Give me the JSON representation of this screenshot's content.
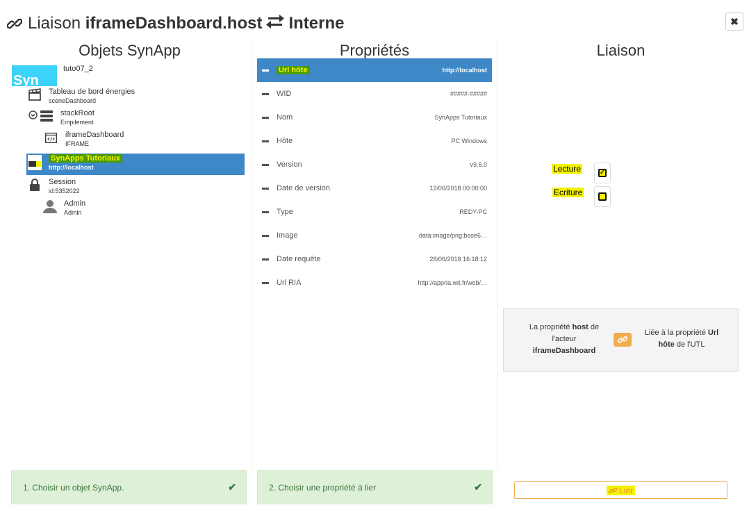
{
  "header": {
    "prefix": "Liaison",
    "source": "iframeDashboard.host",
    "target": "Interne",
    "close_label": "✖"
  },
  "columns": {
    "objects_title": "Objets SynApp",
    "properties_title": "Propriétés",
    "liaison_title": "Liaison"
  },
  "tree": {
    "logo_text": "Syn",
    "root_label": "tuto07_2",
    "items": [
      {
        "label": "Tableau de bord énergies",
        "sub": "sceneDashboard"
      },
      {
        "label": "stackRoot",
        "sub": "Empilement"
      },
      {
        "label": "iframeDashboard",
        "sub": "IFRAME"
      },
      {
        "label": "SynApps Tutoriaux",
        "sub": "http://localhost"
      },
      {
        "label": "Session",
        "sub": "id:5352022"
      },
      {
        "label": "Admin",
        "sub": "Admin"
      }
    ]
  },
  "properties": [
    {
      "name": "Url hôte",
      "value": "http://localhost"
    },
    {
      "name": "WID",
      "value": "#####-#####"
    },
    {
      "name": "Nom",
      "value": "SynApps Tutoriaux"
    },
    {
      "name": "Hôte",
      "value": "PC Windows"
    },
    {
      "name": "Version",
      "value": "v9.6.0"
    },
    {
      "name": "Date de version",
      "value": "12/06/2018 00:00:00"
    },
    {
      "name": "Type",
      "value": "REDY-PC"
    },
    {
      "name": "Image",
      "value": "data:image/png;base6…"
    },
    {
      "name": "Date requête",
      "value": "28/06/2018 16:18:12"
    },
    {
      "name": "Url RIA",
      "value": "http://appria.wit.fr/web/…"
    }
  ],
  "liaison": {
    "read_label": "Lecture",
    "write_label": "Ecriture",
    "read_checked": true,
    "write_checked": false,
    "info_left": {
      "a": "La propriété ",
      "b": "host",
      "c": " de l'acteur ",
      "d": "iframeDashboard"
    },
    "info_right": {
      "a": "Liée à la propriété ",
      "b": "Url hôte",
      "c": " de l'UTL"
    }
  },
  "steps": {
    "step1": "1. Choisir un objet SynApp.",
    "step2": "2. Choisir une propriété à lier",
    "check": "✔"
  },
  "lier_label": "Lier",
  "colors": {
    "selected": "#3f88c8",
    "success_bg": "#dff0d8",
    "success_text": "#3c763d",
    "warning": "#f0ad4e",
    "highlight": "#f4f200"
  }
}
